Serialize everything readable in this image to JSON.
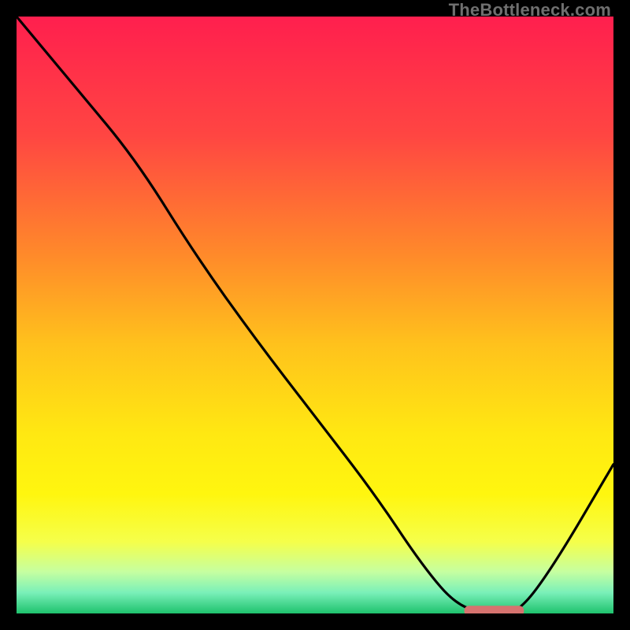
{
  "watermark": "TheBottleneck.com",
  "chart_data": {
    "type": "line",
    "title": "",
    "xlabel": "",
    "ylabel": "",
    "xlim": [
      0,
      100
    ],
    "ylim": [
      0,
      100
    ],
    "background_gradient_stops": [
      {
        "offset": 0.0,
        "color": "#ff1f4e"
      },
      {
        "offset": 0.2,
        "color": "#ff4642"
      },
      {
        "offset": 0.4,
        "color": "#ff8a2a"
      },
      {
        "offset": 0.55,
        "color": "#ffc21c"
      },
      {
        "offset": 0.7,
        "color": "#ffe812"
      },
      {
        "offset": 0.8,
        "color": "#fff60f"
      },
      {
        "offset": 0.88,
        "color": "#f5ff4a"
      },
      {
        "offset": 0.93,
        "color": "#c6ffa0"
      },
      {
        "offset": 0.965,
        "color": "#7af0b9"
      },
      {
        "offset": 1.0,
        "color": "#1ec26d"
      }
    ],
    "series": [
      {
        "name": "bottleneck-curve",
        "color": "#000000",
        "x": [
          0,
          10,
          20,
          30,
          40,
          50,
          60,
          68,
          74,
          80,
          84,
          90,
          100
        ],
        "y": [
          100,
          88,
          76,
          60,
          46,
          33,
          20,
          8,
          1,
          0,
          0,
          8,
          25
        ]
      }
    ],
    "marker": {
      "name": "optimal-zone",
      "x_center": 80,
      "y": 0.5,
      "width_pct": 10,
      "color": "#d6736f"
    }
  }
}
